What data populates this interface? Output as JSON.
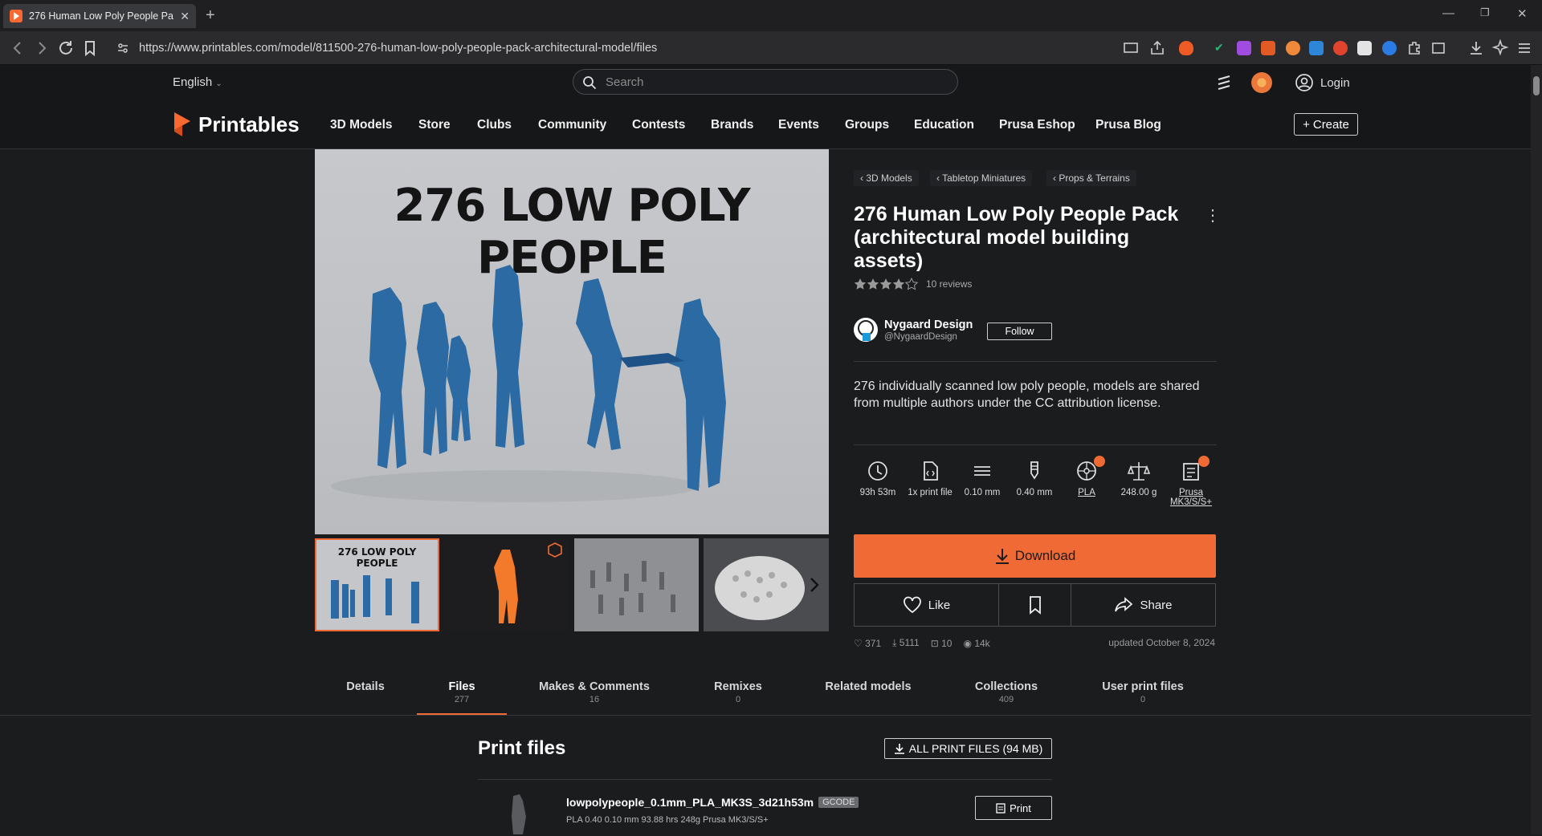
{
  "browser": {
    "tab_title": "276 Human Low Poly People Pac",
    "url": "https://www.printables.com/model/811500-276-human-low-poly-people-pack-architectural-model/files"
  },
  "site": {
    "language": "English",
    "search_placeholder": "Search",
    "login": "Login",
    "logo": "Printables",
    "nav": [
      "3D Models",
      "Store",
      "Clubs",
      "Community",
      "Contests",
      "Brands",
      "Events",
      "Groups",
      "Education",
      "Prusa Eshop",
      "Prusa Blog"
    ],
    "create": "Create",
    "accent": "#f06a35"
  },
  "model": {
    "hero_text": "276 LOW POLY PEOPLE",
    "thumb_text": "276 LOW POLY PEOPLE",
    "breadcrumbs": [
      "3D Models",
      "Tabletop Miniatures",
      "Props & Terrains"
    ],
    "title": "276 Human Low Poly People Pack (architectural model building assets)",
    "rating": 4.5,
    "reviews": "10 reviews",
    "author_name": "Nygaard Design",
    "author_handle": "@NygaardDesign",
    "follow": "Follow",
    "description": "276 individually scanned low poly people, models are shared from multiple authors under the CC attribution license.",
    "specs": [
      {
        "icon": "clock-icon",
        "label": "93h 53m"
      },
      {
        "icon": "file-icon",
        "label": "1x print file"
      },
      {
        "icon": "layer-height-icon",
        "label": "0.10 mm"
      },
      {
        "icon": "nozzle-icon",
        "label": "0.40 mm"
      },
      {
        "icon": "filament-icon",
        "label": "PLA"
      },
      {
        "icon": "scale-icon",
        "label": "248.00 g"
      },
      {
        "icon": "printer-icon",
        "label": "Prusa MK3/S/S+"
      }
    ],
    "download": "Download",
    "like": "Like",
    "share": "Share",
    "stats": {
      "likes": "371",
      "downloads": "5111",
      "makes": "10",
      "views": "14k"
    },
    "updated": "updated October 8, 2024"
  },
  "tabs": [
    {
      "label": "Details",
      "count": ""
    },
    {
      "label": "Files",
      "count": "277"
    },
    {
      "label": "Makes & Comments",
      "count": "16"
    },
    {
      "label": "Remixes",
      "count": "0"
    },
    {
      "label": "Related models",
      "count": ""
    },
    {
      "label": "Collections",
      "count": "409"
    },
    {
      "label": "User print files",
      "count": "0"
    }
  ],
  "files": {
    "heading": "Print files",
    "all_button": "ALL PRINT FILES (94 MB)",
    "item": {
      "name": "lowpolypeople_0.1mm_PLA_MK3S_3d21h53m",
      "type": "GCODE",
      "meta": "PLA   0.40   0.10 mm   93.88 hrs   248g   Prusa MK3/S/S+",
      "print": "Print"
    }
  }
}
